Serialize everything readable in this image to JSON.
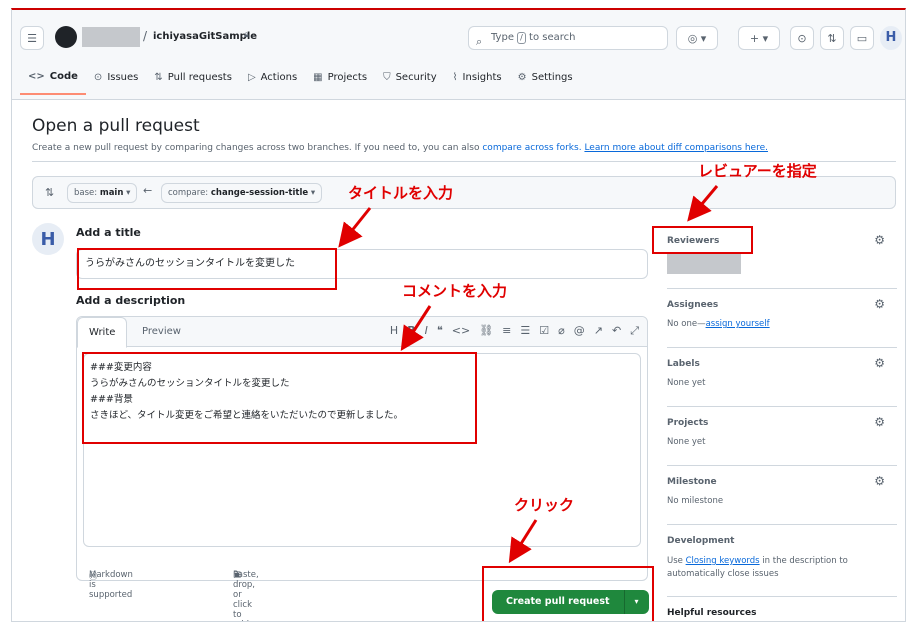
{
  "header": {
    "repo_name": "ichiyasaGitSample",
    "search_placeholder_before": "Type",
    "search_key": "/",
    "search_placeholder_after": "to search"
  },
  "nav": {
    "tabs": [
      {
        "label": "Code",
        "icon": "code-icon"
      },
      {
        "label": "Issues",
        "icon": "issue-icon"
      },
      {
        "label": "Pull requests",
        "icon": "pull-request-icon"
      },
      {
        "label": "Actions",
        "icon": "play-icon"
      },
      {
        "label": "Projects",
        "icon": "table-icon"
      },
      {
        "label": "Security",
        "icon": "shield-icon"
      },
      {
        "label": "Insights",
        "icon": "graph-icon"
      },
      {
        "label": "Settings",
        "icon": "gear-icon"
      }
    ]
  },
  "page": {
    "title": "Open a pull request",
    "subtitle": "Create a new pull request by comparing changes across two branches. If you need to, you can also",
    "compare_forks_link": "compare across forks.",
    "diff_link": "Learn more about diff comparisons here."
  },
  "branches": {
    "base_label": "base:",
    "base_value": "main",
    "compare_label": "compare:",
    "compare_value": "change-session-title"
  },
  "form": {
    "title_label": "Add a title",
    "title_value": "うらがみさんのセッションタイトルを変更した",
    "description_label": "Add a description",
    "tab_write": "Write",
    "tab_preview": "Preview",
    "description_value": "###変更内容\nうらがみさんのセッションタイトルを変更した\n###背景\nさきほど、タイトル変更をご希望と連絡をいただいたので更新しました。",
    "markdown_note": "Markdown is supported",
    "attach_note": "Paste, drop, or click to add files",
    "submit_label": "Create pull request"
  },
  "sidebar": {
    "reviewers": "Reviewers",
    "assignees": "Assignees",
    "assignees_value_prefix": "No one—",
    "assignees_link": "assign yourself",
    "labels": "Labels",
    "labels_value": "None yet",
    "projects": "Projects",
    "projects_value": "None yet",
    "milestone": "Milestone",
    "milestone_value": "No milestone",
    "development": "Development",
    "development_prefix": "Use",
    "development_link": "Closing keywords",
    "development_suffix": "in the description to",
    "development_line2": "automatically close issues",
    "helpful": "Helpful resources"
  },
  "annotations": {
    "reviewer": "レビュアーを指定",
    "title": "タイトルを入力",
    "comment": "コメントを入力",
    "click": "クリック"
  },
  "colors": {
    "annotation_red": "#e00000",
    "submit_green": "#1f883d",
    "link_blue": "#0969da"
  }
}
